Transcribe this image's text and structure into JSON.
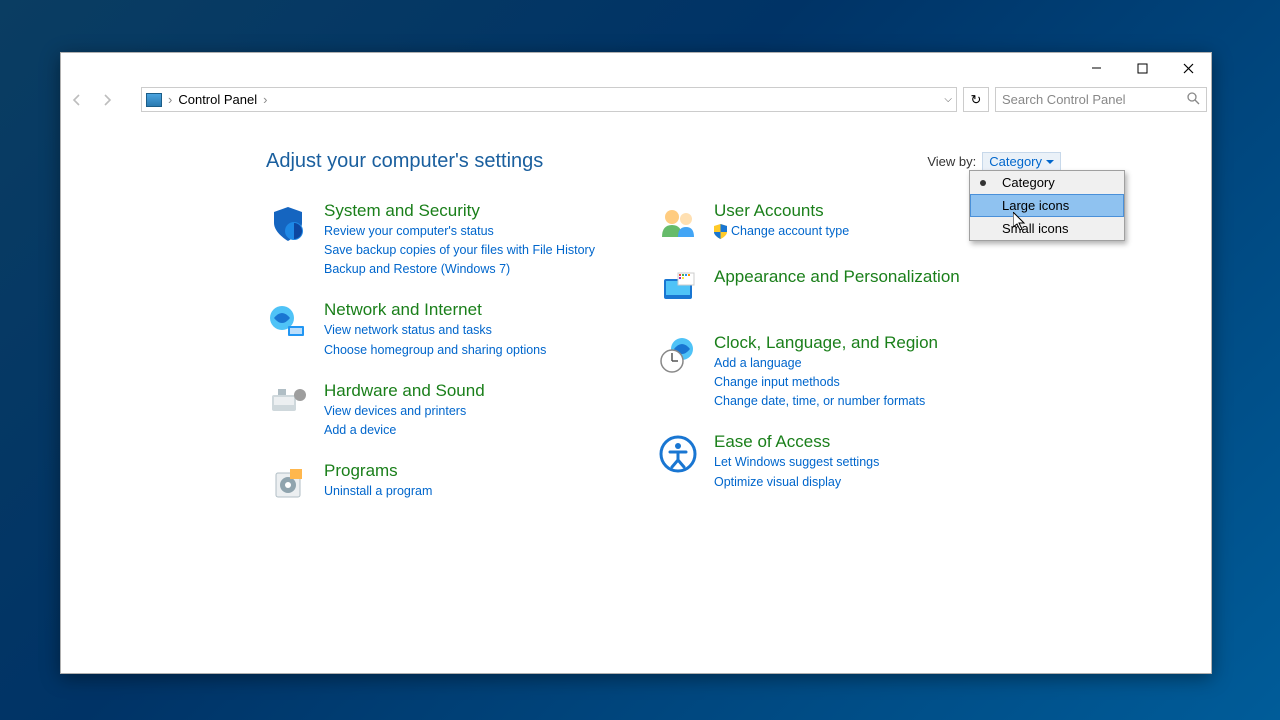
{
  "window": {
    "breadcrumb": "Control Panel",
    "search_placeholder": "Search Control Panel"
  },
  "heading": "Adjust your computer's settings",
  "viewby": {
    "label": "View by:",
    "value": "Category",
    "options": [
      "Category",
      "Large icons",
      "Small icons"
    ],
    "selected_index": 0,
    "highlight_index": 1
  },
  "categories": {
    "left": [
      {
        "title": "System and Security",
        "links": [
          "Review your computer's status",
          "Save backup copies of your files with File History",
          "Backup and Restore (Windows 7)"
        ]
      },
      {
        "title": "Network and Internet",
        "links": [
          "View network status and tasks",
          "Choose homegroup and sharing options"
        ]
      },
      {
        "title": "Hardware and Sound",
        "links": [
          "View devices and printers",
          "Add a device"
        ]
      },
      {
        "title": "Programs",
        "links": [
          "Uninstall a program"
        ]
      }
    ],
    "right": [
      {
        "title": "User Accounts",
        "links": [
          "Change account type"
        ],
        "shield": [
          true
        ]
      },
      {
        "title": "Appearance and Personalization",
        "links": []
      },
      {
        "title": "Clock, Language, and Region",
        "links": [
          "Add a language",
          "Change input methods",
          "Change date, time, or number formats"
        ]
      },
      {
        "title": "Ease of Access",
        "links": [
          "Let Windows suggest settings",
          "Optimize visual display"
        ]
      }
    ]
  }
}
